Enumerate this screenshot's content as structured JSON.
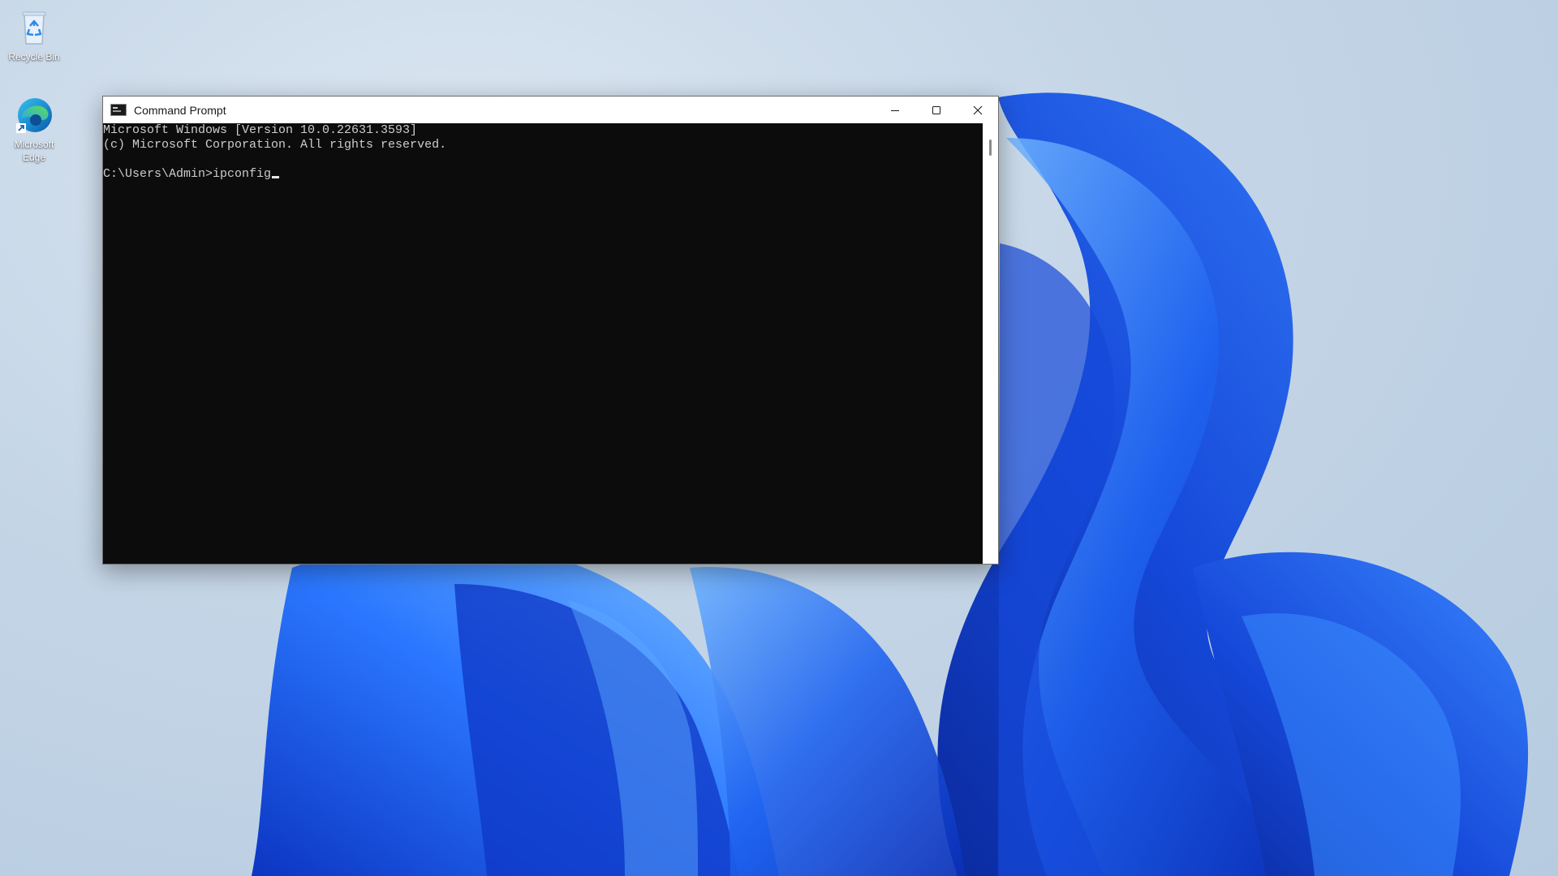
{
  "desktop": {
    "icons": [
      {
        "label": "Recycle Bin",
        "icon": "recycle-bin-icon"
      },
      {
        "label": "Microsoft Edge",
        "icon": "edge-icon"
      }
    ],
    "colors": {
      "wallpaper_bloom": "#1a5ee6",
      "background": "#c4d5e6"
    }
  },
  "window": {
    "title": "Command Prompt",
    "app_icon": "cmd-icon",
    "caption_buttons": {
      "minimize": "minimize-icon",
      "maximize": "maximize-icon",
      "close": "close-icon"
    },
    "console": {
      "lines": [
        "Microsoft Windows [Version 10.0.22631.3593]",
        "(c) Microsoft Corporation. All rights reserved.",
        ""
      ],
      "prompt": "C:\\Users\\Admin>",
      "input": "ipconfig"
    }
  }
}
